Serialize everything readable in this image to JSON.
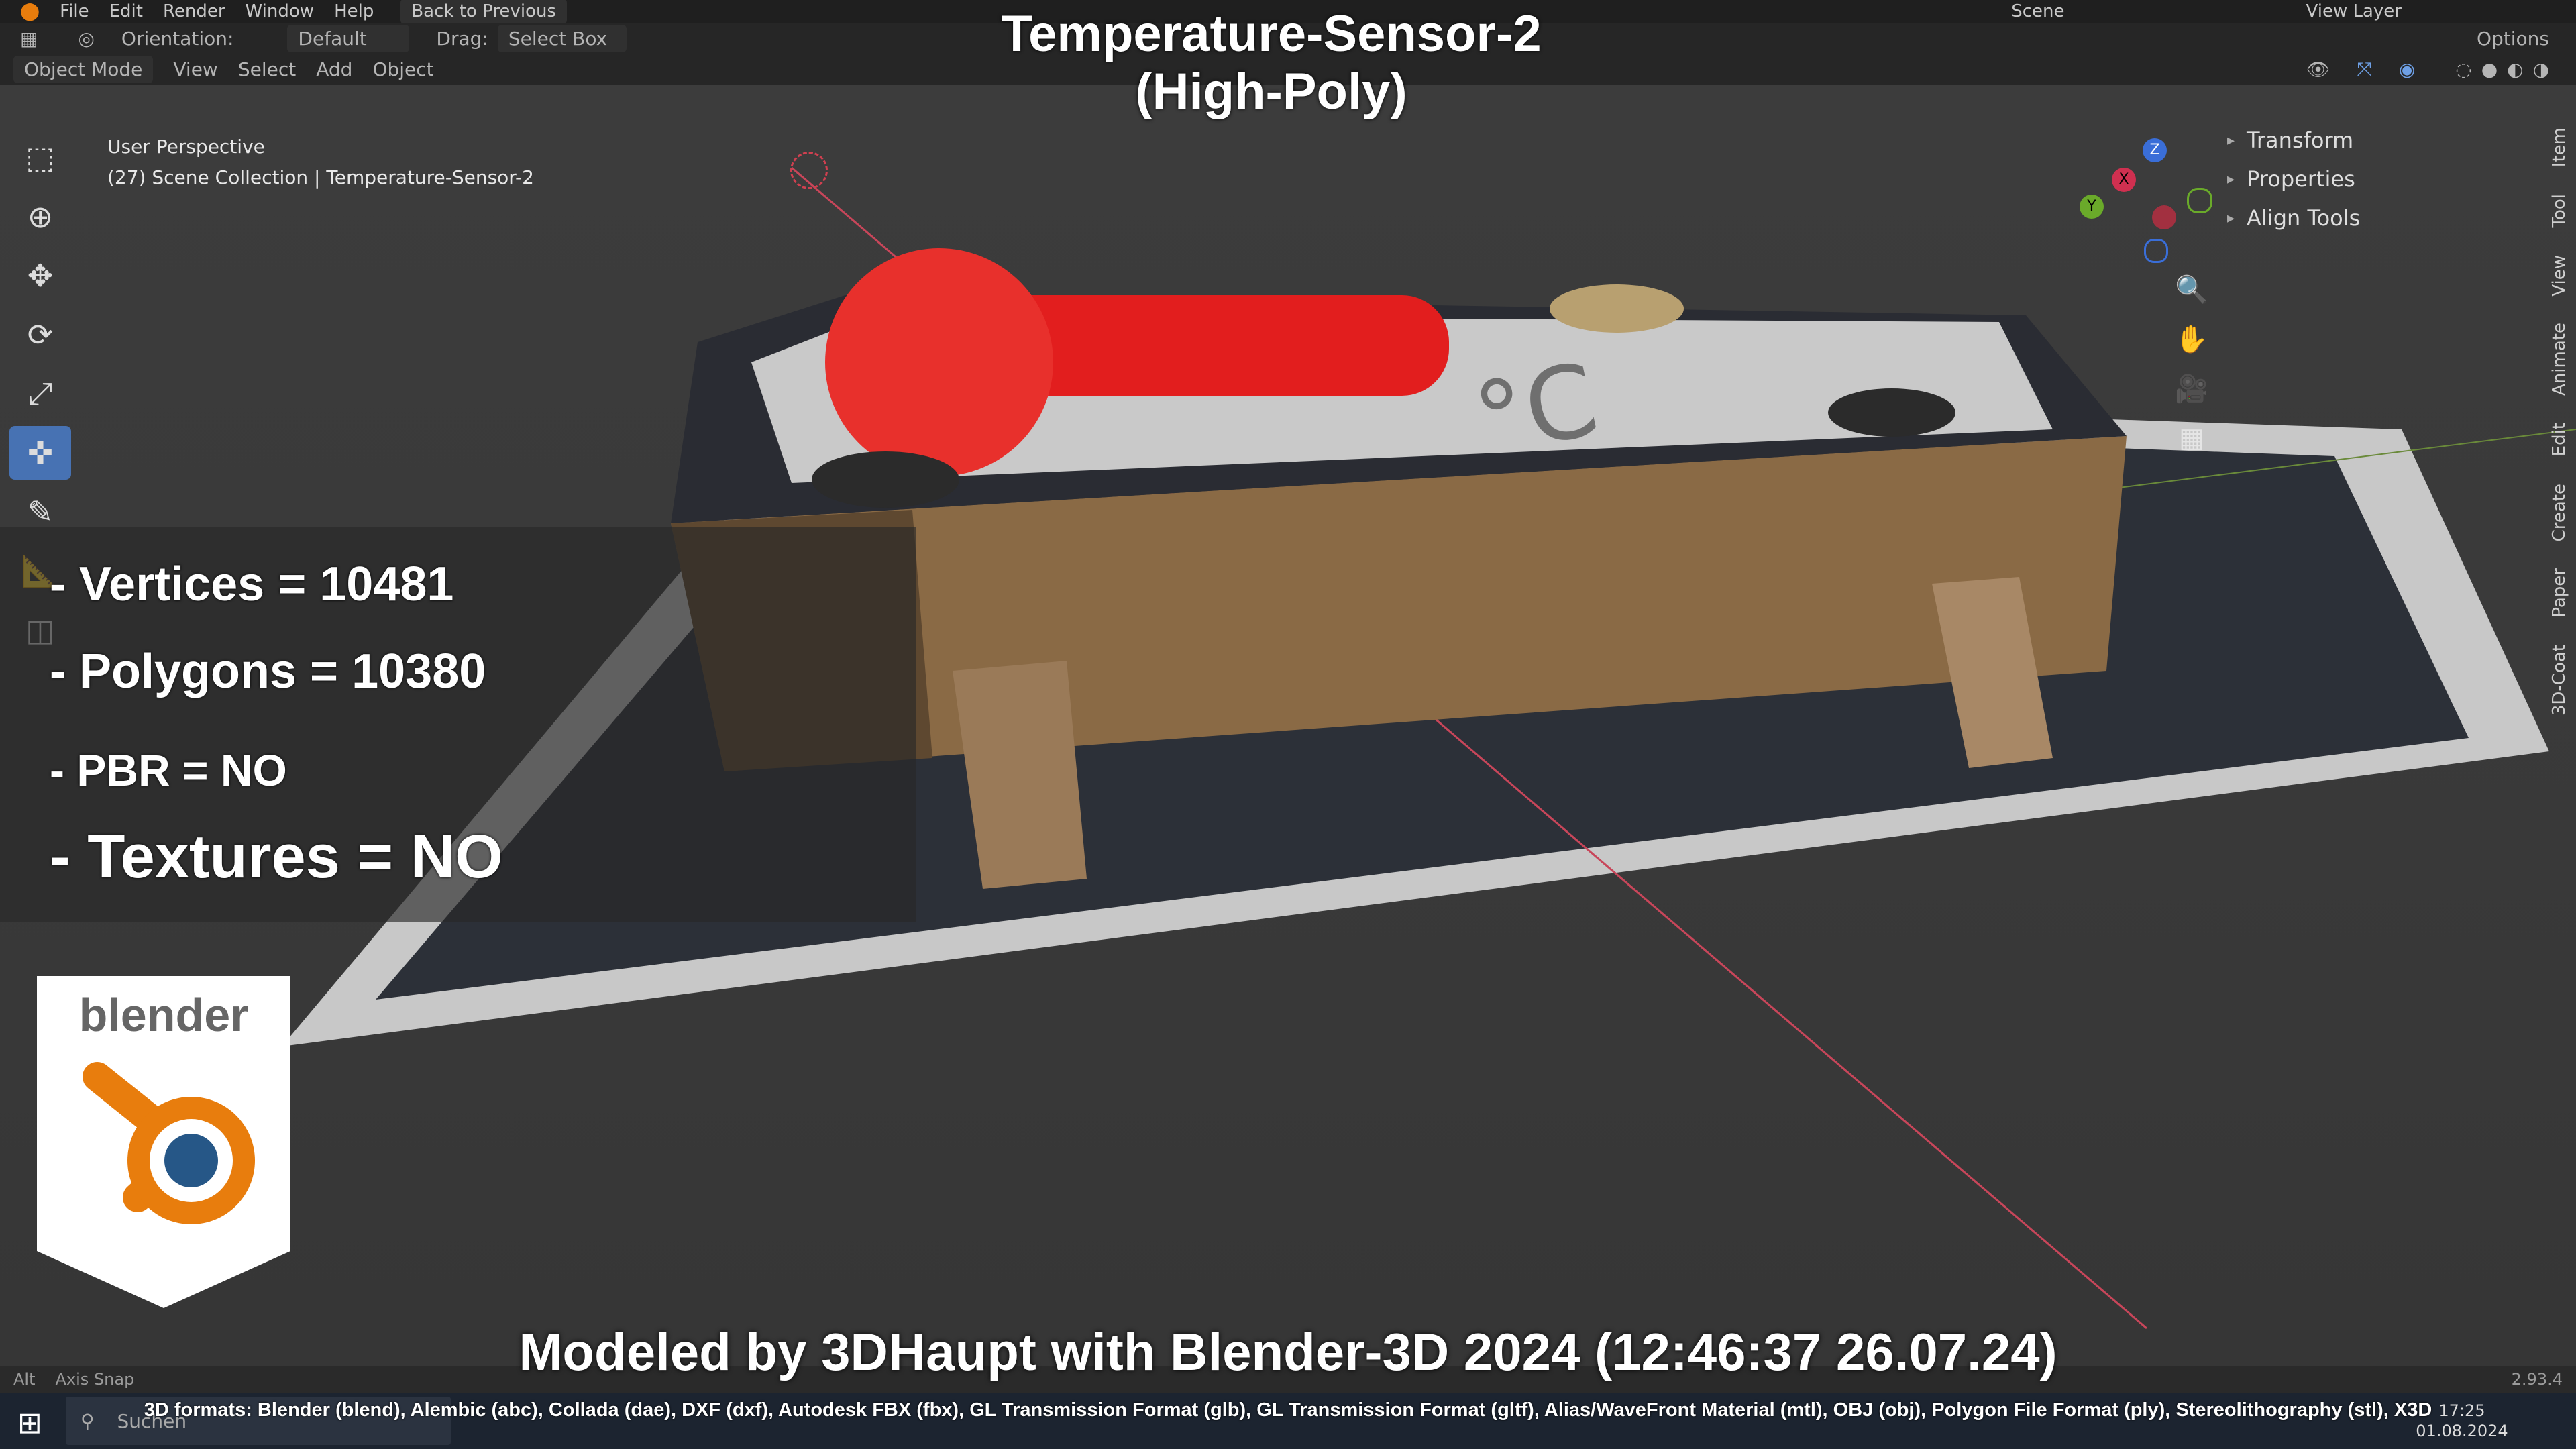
{
  "menubar": {
    "items": [
      "File",
      "Edit",
      "Render",
      "Window",
      "Help"
    ],
    "back_label": "Back to Previous",
    "scene_label": "Scene",
    "view_layer_label": "View Layer"
  },
  "header": {
    "orientation_label": "Orientation:",
    "orientation_value": "Default",
    "drag_label": "Drag:",
    "drag_value": "Select Box",
    "options_label": "Options",
    "mode_label": "Object Mode",
    "menus": [
      "View",
      "Select",
      "Add",
      "Object"
    ]
  },
  "viewport": {
    "perspective": "User Perspective",
    "collection": "(27) Scene Collection | Temperature-Sensor-2"
  },
  "npanel": {
    "items": [
      "Transform",
      "Properties",
      "Align Tools"
    ],
    "tabs": [
      "Item",
      "Tool",
      "View",
      "Animate",
      "Edit",
      "Create",
      "Paper",
      "3D-Coat"
    ]
  },
  "gizmo": {
    "x": "X",
    "y": "Y",
    "z": "Z"
  },
  "overlay": {
    "title_line1": "Temperature-Sensor-2",
    "title_line2": "(High-Poly)",
    "vertices": "- Vertices = 10481",
    "polygons": "- Polygons = 10380",
    "pbr": "- PBR =  NO",
    "textures": "- Textures = NO",
    "logo_text": "blender",
    "credit": "Modeled by 3DHaupt with Blender-3D 2024 (12:46:37  26.07.24)",
    "formats": "3D formats: Blender (blend), Alembic (abc), Collada (dae), DXF (dxf), Autodesk FBX (fbx), GL Transmission Format (glb), GL Transmission Format (gltf), Alias/WaveFront Material (mtl), OBJ (obj), Polygon File Format (ply), Stereolithography (stl), X3D"
  },
  "statusbar": {
    "hint": "Axis Snap",
    "alt": "Alt",
    "version": "2.93.4"
  },
  "taskbar": {
    "search_placeholder": "Suchen",
    "time": "17:25",
    "date": "01.08.2024"
  },
  "colors": {
    "accent": "#4772b3",
    "thermo_red": "#e21e1e",
    "blender_orange": "#e87d0d",
    "blender_blue": "#265787"
  }
}
